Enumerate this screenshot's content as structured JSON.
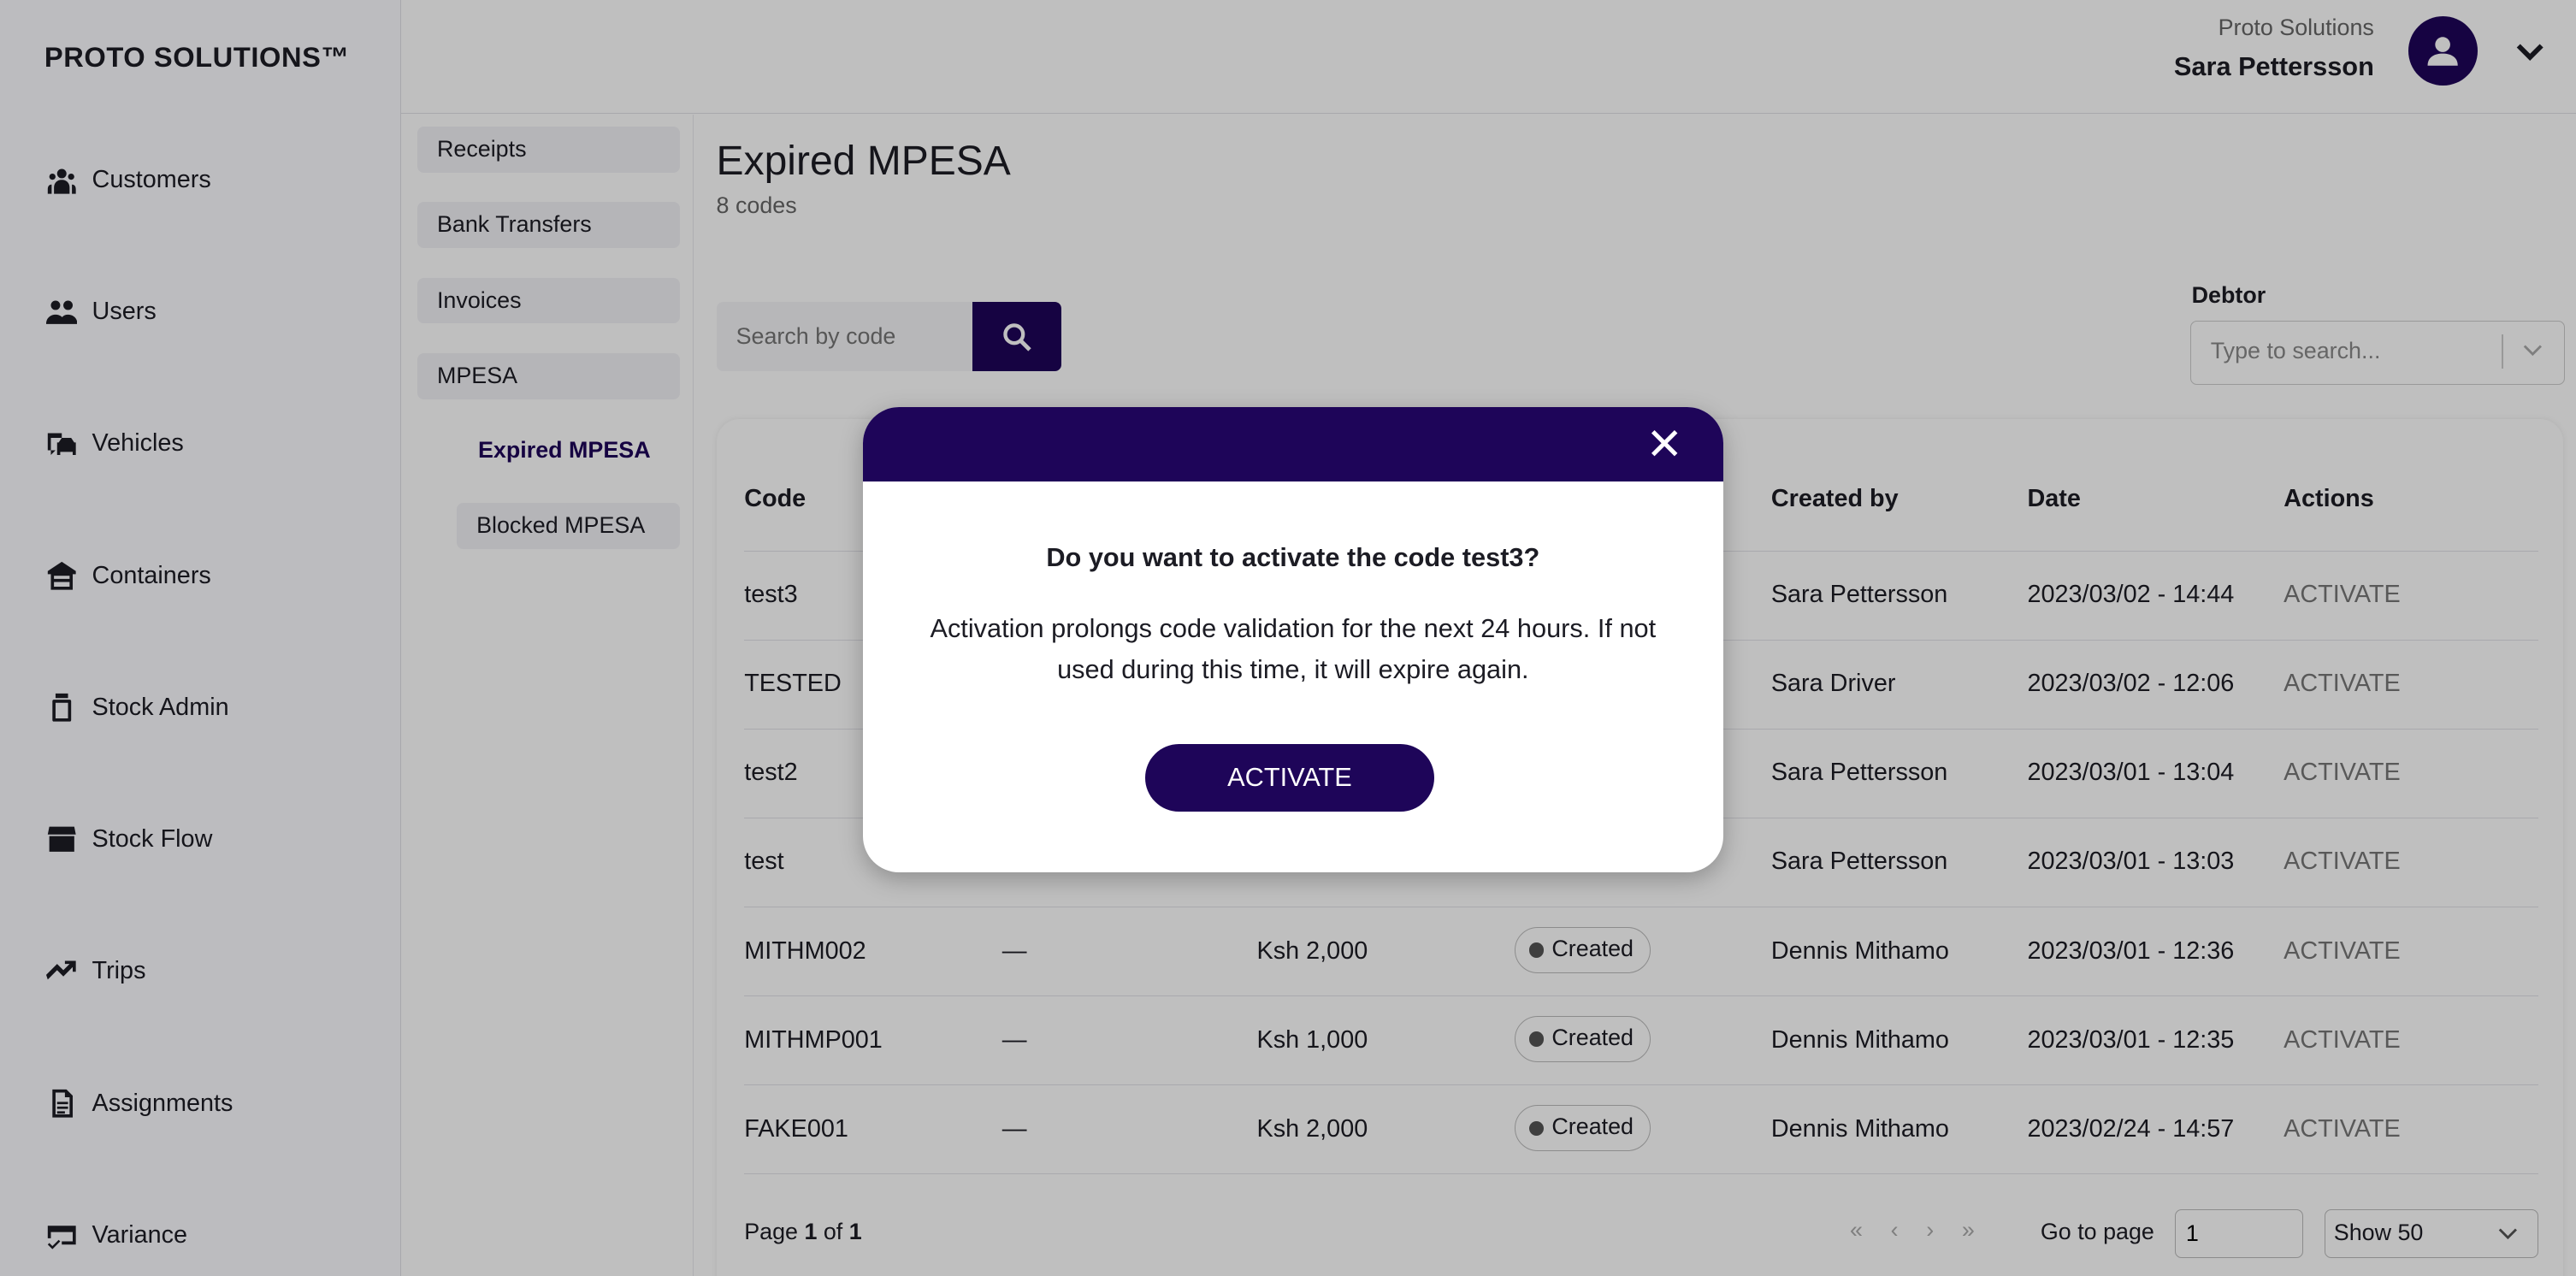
{
  "brand": "PROTO SOLUTIONS™",
  "accent": "#1e0559",
  "sidebar": {
    "items": [
      {
        "label": "Customers",
        "icon": "customers-icon"
      },
      {
        "label": "Users",
        "icon": "users-icon"
      },
      {
        "label": "Vehicles",
        "icon": "vehicles-icon"
      },
      {
        "label": "Containers",
        "icon": "containers-icon"
      },
      {
        "label": "Stock Admin",
        "icon": "stock-admin-icon"
      },
      {
        "label": "Stock Flow",
        "icon": "stock-flow-icon"
      },
      {
        "label": "Trips",
        "icon": "trips-icon"
      },
      {
        "label": "Assignments",
        "icon": "assignments-icon"
      },
      {
        "label": "Variance",
        "icon": "variance-icon"
      }
    ]
  },
  "subnav": {
    "items": [
      "Receipts",
      "Bank Transfers",
      "Invoices",
      "MPESA"
    ],
    "sub_active": "Expired MPESA",
    "sub_other": "Blocked MPESA"
  },
  "header": {
    "org": "Proto Solutions",
    "user": "Sara Pettersson"
  },
  "main": {
    "title": "Expired MPESA",
    "count": "8 codes",
    "search_placeholder": "Search by code",
    "debtor_label": "Debtor",
    "debtor_placeholder": "Type to search..."
  },
  "table": {
    "headers": [
      "Code",
      "",
      "",
      "",
      "Created by",
      "Date",
      "Actions"
    ],
    "rows": [
      [
        "test3",
        "",
        "",
        "",
        "Sara Pettersson",
        "2023/03/02 - 14:44",
        "ACTIVATE"
      ],
      [
        "TESTED",
        "",
        "",
        "",
        "Sara Driver",
        "2023/03/02 - 12:06",
        "ACTIVATE"
      ],
      [
        "test2",
        "",
        "",
        "",
        "Sara Pettersson",
        "2023/03/01 - 13:04",
        "ACTIVATE"
      ],
      [
        "test",
        "",
        "",
        "",
        "Sara Pettersson",
        "2023/03/01 - 13:03",
        "ACTIVATE"
      ],
      [
        "MITHM002",
        "—",
        "Ksh 2,000",
        "Created",
        "Dennis Mithamo",
        "2023/03/01 - 12:36",
        "ACTIVATE"
      ],
      [
        "MITHMP001",
        "—",
        "Ksh 1,000",
        "Created",
        "Dennis Mithamo",
        "2023/03/01 - 12:35",
        "ACTIVATE"
      ],
      [
        "FAKE001",
        "—",
        "Ksh 2,000",
        "Created",
        "Dennis Mithamo",
        "2023/02/24 - 14:57",
        "ACTIVATE"
      ]
    ]
  },
  "pagination": {
    "page_prefix": "Page ",
    "page": "1",
    "of": " of ",
    "total": "1",
    "goto_label": "Go to page",
    "goto_value": "1",
    "show": "Show 50"
  },
  "modal": {
    "question": "Do you want to activate the code test3?",
    "body": "Activation prolongs code validation for the next 24 hours. If not used during this time, it will expire again.",
    "button": "ACTIVATE"
  }
}
